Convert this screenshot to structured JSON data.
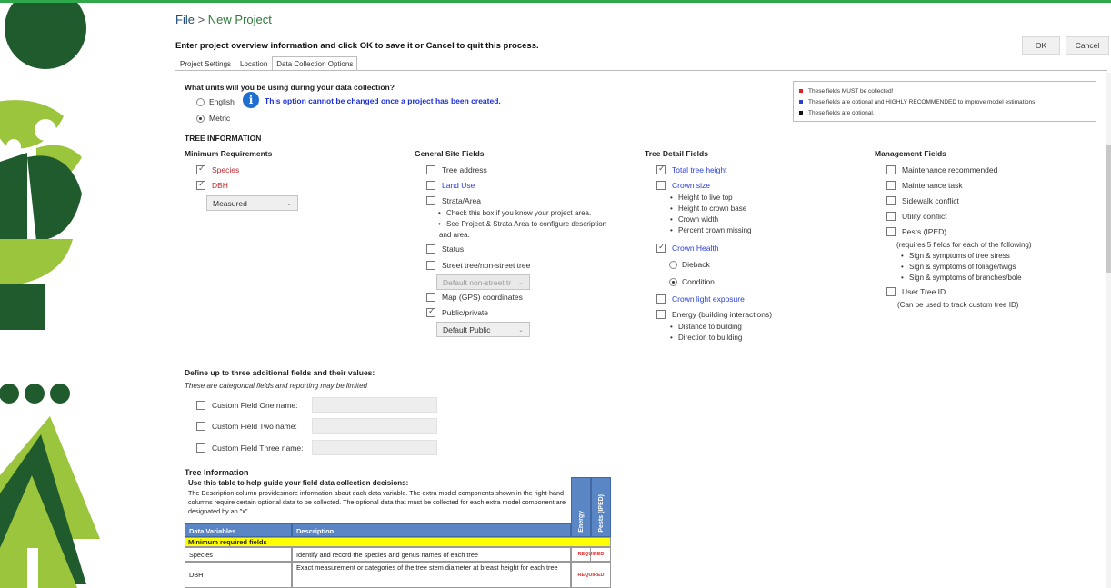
{
  "header": {
    "breadcrumb_file": "File",
    "breadcrumb_sep": ">",
    "breadcrumb_page": "New Project",
    "instructions": "Enter project overview information and click OK to save it or Cancel to quit this process.",
    "ok_label": "OK",
    "cancel_label": "Cancel"
  },
  "tabs": [
    {
      "label": "Project Settings",
      "active": false
    },
    {
      "label": "Location",
      "active": false
    },
    {
      "label": "Data Collection Options",
      "active": true
    }
  ],
  "units": {
    "question": "What units will you be using during your data collection?",
    "options": [
      {
        "label": "English",
        "selected": false
      },
      {
        "label": "Metric",
        "selected": true
      }
    ],
    "info_text": "This option cannot be changed once a project has been created."
  },
  "legend": [
    {
      "color": "#e02020",
      "text": "These fields MUST be collected!"
    },
    {
      "color": "#2a3fd0",
      "text": "These fields are optional and HIGHLY RECOMMENDED to improve model estimations."
    },
    {
      "color": "#111111",
      "text": "These fields are optional."
    }
  ],
  "tree_information_heading": "TREE INFORMATION",
  "minimum": {
    "heading": "Minimum Requirements",
    "species": "Species",
    "dbh": "DBH",
    "dbh_select": "Measured"
  },
  "general": {
    "heading": "General Site Fields",
    "tree_address": "Tree address",
    "land_use": "Land Use",
    "strata": "Strata/Area",
    "strata_note1": "Check this box if you know your project area.",
    "strata_note2a": "See Project & Strata Area to configure description",
    "strata_note2b": "and area.",
    "status": "Status",
    "street_tree": "Street tree/non-street tree",
    "street_select": "Default non-street tr",
    "gps": "Map (GPS) coordinates",
    "public_private": "Public/private",
    "public_select": "Default Public"
  },
  "detail": {
    "heading": "Tree Detail Fields",
    "total_height": "Total tree height",
    "crown_size": "Crown size",
    "crown_b1": "Height to live top",
    "crown_b2": "Height to crown base",
    "crown_b3": "Crown width",
    "crown_b4": "Percent crown missing",
    "crown_health": "Crown Health",
    "dieback": "Dieback",
    "condition": "Condition",
    "crown_light": "Crown light exposure",
    "energy": "Energy (building interactions)",
    "energy_b1": "Distance to building",
    "energy_b2": "Direction to building"
  },
  "management": {
    "heading": "Management Fields",
    "maint_rec": "Maintenance recommended",
    "maint_task": "Maintenance task",
    "sidewalk": "Sidewalk conflict",
    "utility": "Utility conflict",
    "pests": "Pests (IPED)",
    "pests_note": "(requires 5 fields for each of the following)",
    "pests_b1": "Sign & symptoms of tree stress",
    "pests_b2": "Sign & symptoms of foliage/twigs",
    "pests_b3": "Sign & symptoms of branches/bole",
    "user_id": "User Tree ID",
    "user_id_note": "(Can be used to track custom tree ID)"
  },
  "custom": {
    "heading": "Define up to three additional fields and their values:",
    "note": "These are categorical fields and reporting may be limited",
    "f1": "Custom Field One name:",
    "f2": "Custom Field Two name:",
    "f3": "Custom Field Three name:"
  },
  "tree_info_table": {
    "heading": "Tree Information",
    "guide": "Use this table to help guide your field data collection decisions:",
    "desc": "The Description column providesmore information about each data variable. The extra model components shown in the right-hand columns require certain optional data to be collected. The optional data that must be collected for each extra model component are designated by an \"x\".",
    "col_var": "Data Variables",
    "col_desc": "Description",
    "col_energy": "Energy",
    "col_pests": "Pests (IPED)",
    "section": "Minimum required fields",
    "rows": [
      {
        "var": "Species",
        "desc": "Identify and record the species and genus names of each tree",
        "tag": "REQUIRED"
      },
      {
        "var": "DBH",
        "desc": "Exact measurement or categories of the tree stem diameter at breast height for each tree",
        "tag": "REQUIRED"
      }
    ]
  }
}
